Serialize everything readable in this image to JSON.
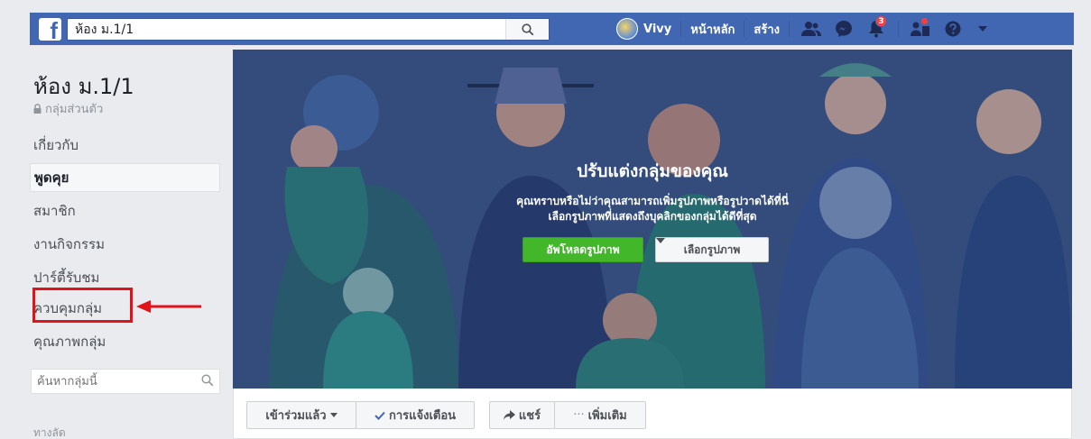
{
  "colors": {
    "topbar": "#4267b2",
    "green_button": "#42b72a",
    "highlight": "#e3121a",
    "cover_bg": "#3e5a8f"
  },
  "topbar": {
    "logo_letter": "f",
    "search_value": "ห้อง ม.1/1",
    "search_icon": "search-icon",
    "user_name": "Vivy",
    "home_label": "หน้าหลัก",
    "create_label": "สร้าง",
    "notification_count": "3",
    "icons": [
      "friends-icon",
      "messenger-icon",
      "bell-icon",
      "quick-help-icon",
      "help-icon",
      "caret-down-icon"
    ]
  },
  "sidebar": {
    "group_name": "ห้อง ม.1/1",
    "privacy": "กลุ่มส่วนตัว",
    "items": [
      {
        "label": "เกี่ยวกับ",
        "active": false
      },
      {
        "label": "พูดคุย",
        "active": true
      },
      {
        "label": "สมาชิก",
        "active": false
      },
      {
        "label": "งานกิจกรรม",
        "active": false
      },
      {
        "label": "ปาร์ตี้รับชม",
        "active": false
      },
      {
        "label": "ควบคุมกลุ่ม",
        "active": false
      },
      {
        "label": "คุณภาพกลุ่ม",
        "active": false
      }
    ],
    "search_placeholder": "ค้นหากลุ่มนี้",
    "shortcuts_label": "ทางลัด"
  },
  "cover": {
    "title": "ปรับแต่งกลุ่มของคุณ",
    "description_line1": "คุณทราบหรือไม่ว่าคุณสามารถเพิ่มรูปภาพหรือรูปวาดได้ที่นี่",
    "description_line2": "เลือกรูปภาพที่แสดงถึงบุคลิกของกลุ่มได้ดีที่สุด",
    "upload_label": "อัพโหลดรูปภาพ",
    "choose_label": "เลือกรูปภาพ"
  },
  "action_bar": {
    "joined_label": "เข้าร่วมแล้ว",
    "notifications_label": "การแจ้งเตือน",
    "share_label": "แชร์",
    "more_label": "เพิ่มเติม"
  }
}
